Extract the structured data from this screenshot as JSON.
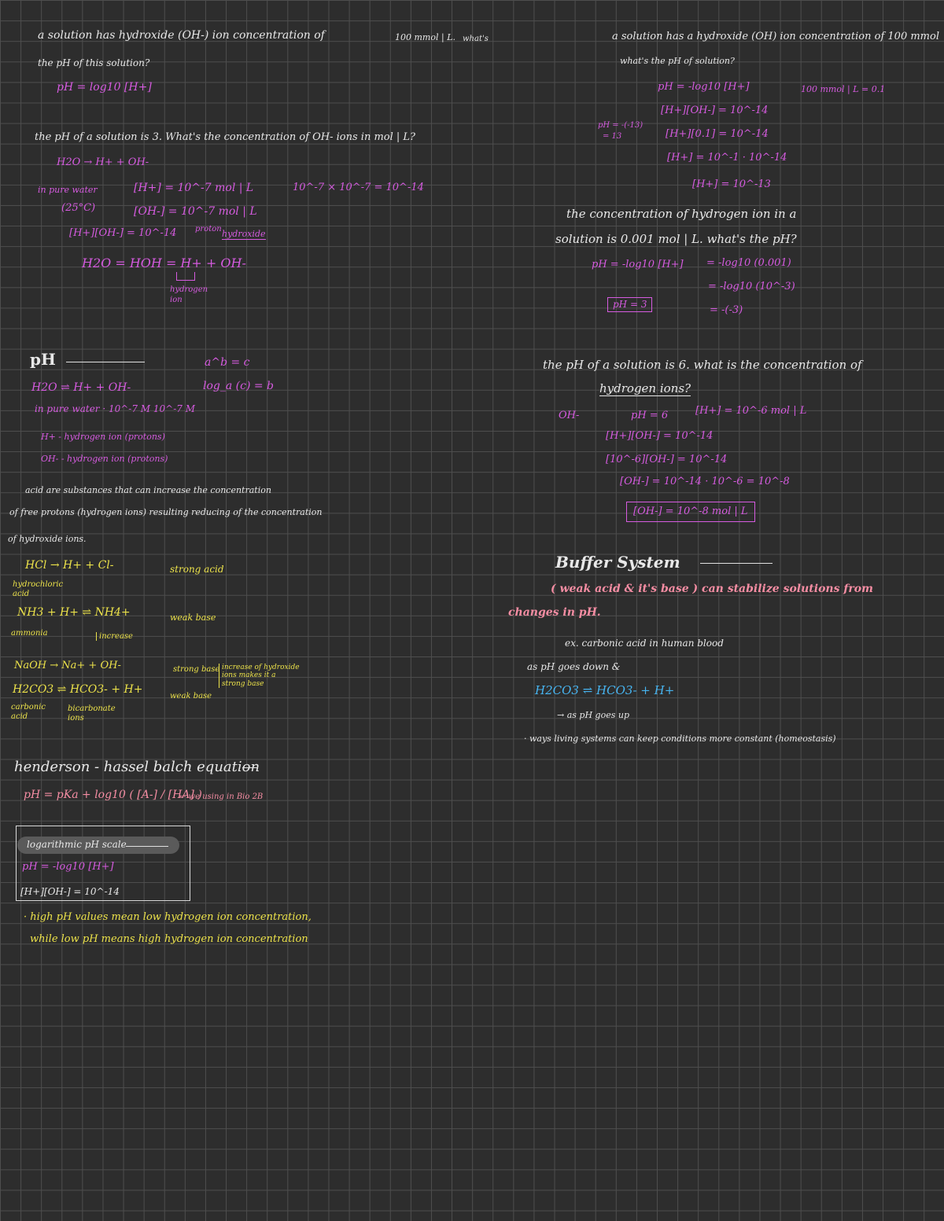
{
  "left": {
    "q1": {
      "line1": "a solution has hydroxide (OH-) ion concentration of",
      "value": "100 mmol | L.",
      "what": "what's",
      "line2": "the pH of this solution?",
      "formula": "pH = log10 [H+]"
    },
    "q2": {
      "text": "the pH of a solution is 3. What's the concentration of OH- ions in mol | L?",
      "eq1": "H2O → H+ + OH-",
      "pure_water": "in pure water",
      "temp": "(25°C)",
      "h_conc": "[H+] = 10^-7 mol | L",
      "oh_conc": "[OH-] = 10^-7 mol | L",
      "product": "[H+][OH-] = 10^-14",
      "proton_label": "proton",
      "hydroxide_label": "hydroxide",
      "calc": "10^-7 × 10^-7 = 10^-14",
      "eq2": "H2O = HOH = H+ + OH-",
      "hydrogen_ion": "hydrogen ion"
    },
    "ph": {
      "title": "pH",
      "eq": "H2O ⇌ H+ + OH-",
      "log_def1": "a^b = c",
      "log_def2": "log_a (c) = b",
      "pure_water": "in pure water · 10^-7 M   10^-7 M",
      "hplus": "H+ - hydrogen ion (protons)",
      "ohminus": "OH- - hydrogen ion (protons)",
      "acid_def1": "acid are substances that can increase the concentration",
      "acid_def2": "of free protons (hydrogen ions) resulting reducing of the concentration",
      "acid_def3": "of hydroxide ions."
    },
    "examples": {
      "hcl": "HCl → H+ + Cl-",
      "hcl_name": "hydrochloric acid",
      "strong_acid": "strong acid",
      "nh3": "NH3 + H+ ⇌ NH4+",
      "nh3_name": "ammonia",
      "nh3_note": "increase",
      "weak_base": "weak base",
      "naoh": "NaOH → Na+ + OH-",
      "strong_base": "strong base",
      "naoh_note": "increase of hydroxide ions makes it a strong base",
      "h2co3": "H2CO3 ⇌ HCO3- + H+",
      "h2co3_name": "carbonic acid",
      "hco3_name": "bicarbonate ions",
      "weak_base2": "weak base"
    },
    "hh": {
      "title": "henderson - hassel balch equation",
      "formula": "pH = pKa + log10 ( [A-] / [HA] )",
      "note": "← we using in Bio 2B"
    },
    "log_scale": {
      "title": "logarithmic pH scale",
      "eq1": "pH = -log10 [H+]",
      "eq2": "[H+][OH-] = 10^-14"
    },
    "summary1": "· high pH values mean low hydrogen ion concentration,",
    "summary2": "while low pH means high hydrogen ion concentration"
  },
  "right": {
    "q1": {
      "line1": "a solution has a hydroxide (OH) ion concentration of 100 mmol",
      "line2": "what's the pH of solution?",
      "s1": "pH = -log10 [H+]",
      "s1b": "100 mmol | L = 0.1",
      "s2": "[H+][OH-] = 10^-14",
      "s3": "[H+][0.1] = 10^-14",
      "side": "pH = -(-13)",
      "side2": "= 13",
      "s4": "[H+] = 10^-1 · 10^-14",
      "s5": "[H+] = 10^-13"
    },
    "q2": {
      "line1": "the concentration of hydrogen ion in a",
      "line2": "solution is 0.001 mol | L. what's the pH?",
      "s1": "pH = -log10 [H+]",
      "s2": "= -log10 (0.001)",
      "s3": "= -log10 (10^-3)",
      "s4": "= -(-3)",
      "answer": "pH = 3"
    },
    "q3": {
      "line1": "the pH of a solution is 6. what is the concentration of",
      "line2": "hydrogen ions?",
      "oh": "OH-",
      "s1": "pH = 6",
      "s1b": "[H+] = 10^-6 mol | L",
      "s2": "[H+][OH-] = 10^-14",
      "s3": "[10^-6][OH-] = 10^-14",
      "s4": "[OH-] = 10^-14 · 10^-6 = 10^-8",
      "answer": "[OH-] = 10^-8 mol | L"
    },
    "buffer": {
      "title": "Buffer System",
      "def1": "( weak acid & it's base ) can stabilize solutions from",
      "def2": "changes in pH.",
      "ex": "ex. carbonic acid in human blood",
      "down": "as pH goes down   &",
      "eq": "H2CO3 ⇌ HCO3- + H+",
      "up": "→ as pH goes up",
      "ways": "· ways living systems can keep conditions more constant (homeostasis)"
    }
  }
}
